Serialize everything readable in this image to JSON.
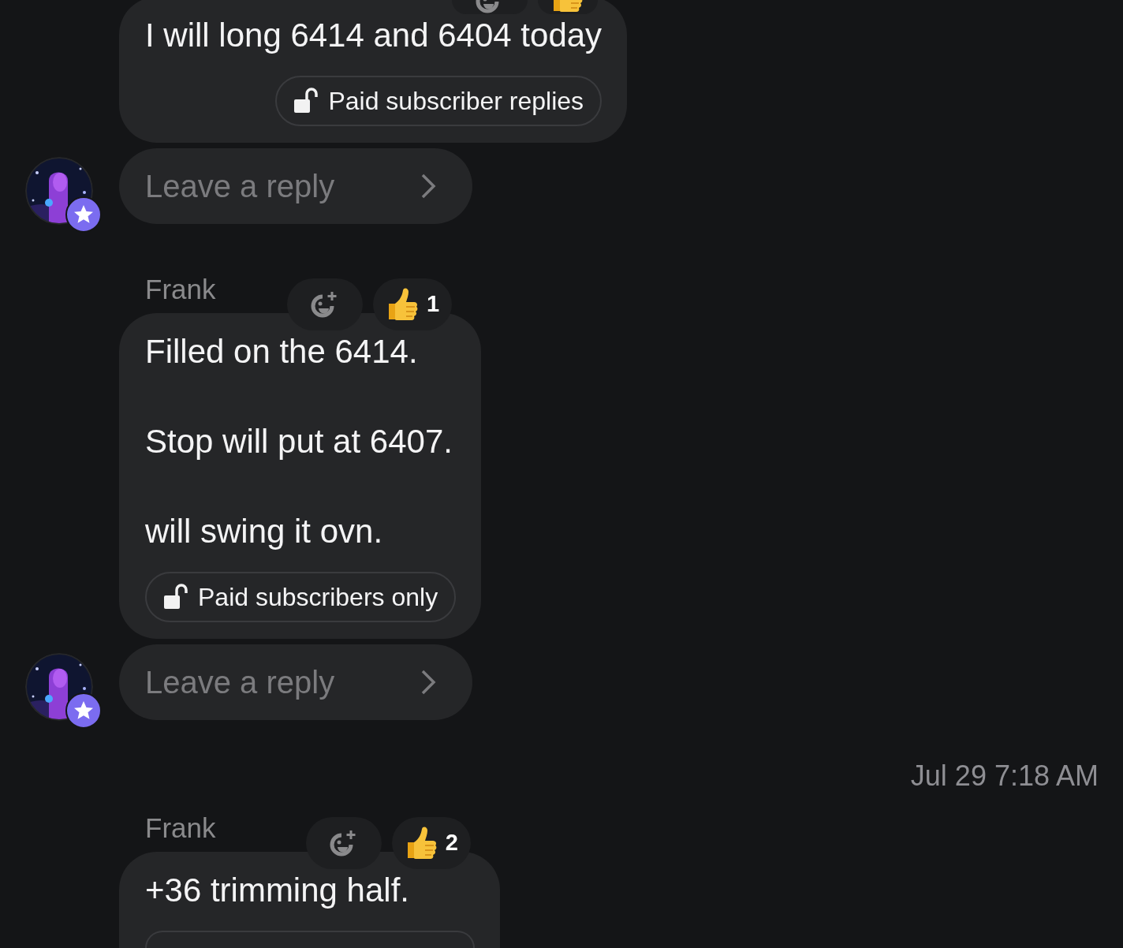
{
  "feed": [
    {
      "kind": "message",
      "cut_at_top": true,
      "reactions": [
        {
          "kind": "add"
        },
        {
          "kind": "thumbs_up"
        }
      ],
      "paragraphs": [
        "I will long 6414 and 6404 today"
      ],
      "paid_chip": {
        "label": "Paid subscriber replies"
      },
      "reply": {
        "placeholder": "Leave a reply"
      }
    },
    {
      "kind": "message",
      "sender": "Frank",
      "reactions": [
        {
          "kind": "add"
        },
        {
          "kind": "thumbs_up",
          "count": "1"
        }
      ],
      "paragraphs": [
        "Filled on the 6414.",
        "Stop will put at 6407.",
        "will swing it ovn."
      ],
      "paid_chip": {
        "label": "Paid subscribers only"
      },
      "reply": {
        "placeholder": "Leave a reply"
      }
    },
    {
      "kind": "timestamp",
      "text": "Jul 29 7:18 AM"
    },
    {
      "kind": "message",
      "sender": "Frank",
      "reactions": [
        {
          "kind": "add"
        },
        {
          "kind": "thumbs_up",
          "count": "2"
        }
      ],
      "paragraphs": [
        "+36 trimming half."
      ],
      "paid_chip_partial": true
    }
  ]
}
